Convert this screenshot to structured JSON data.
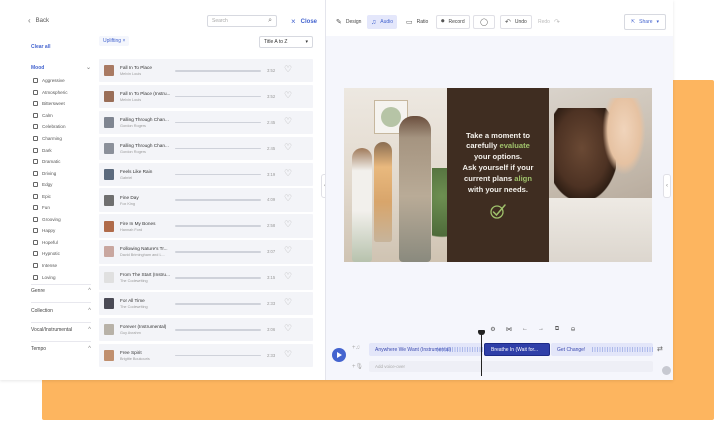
{
  "filter": {
    "back_label": "Back",
    "clear_all_label": "Clear all",
    "mood_title": "Mood",
    "moods": [
      "Aggressive",
      "Atmospheric",
      "Bittersweet",
      "Calm",
      "Celebration",
      "Charming",
      "Dark",
      "Dramatic",
      "Driving",
      "Edgy",
      "Epic",
      "Fun",
      "Grooving",
      "Happy",
      "Hopeful",
      "Hypnotic",
      "Intense",
      "Loving"
    ],
    "groups": [
      "Genre",
      "Collection",
      "Vocal/Instrumental",
      "Tempo"
    ]
  },
  "tracks_panel": {
    "search_placeholder": "Search",
    "close_label": "Close",
    "active_chip": "Uplifting",
    "sort_value": "Title A to Z",
    "tracks": [
      {
        "name": "Fall In To Place",
        "artist": "Melvin Louis",
        "duration": "3:52",
        "color": "#a97a63"
      },
      {
        "name": "Fall In To Place (Instru...",
        "artist": "Melvin Louis",
        "duration": "3:52",
        "color": "#9a6e58"
      },
      {
        "name": "Falling Through Chan...",
        "artist": "Gordon Rogers",
        "duration": "2:45",
        "color": "#7f8591"
      },
      {
        "name": "Falling Through Chan...",
        "artist": "Gordon Rogers",
        "duration": "2:45",
        "color": "#8b909a"
      },
      {
        "name": "Feels Like Rain",
        "artist": "Gabriel",
        "duration": "3:19",
        "color": "#5c6a7d"
      },
      {
        "name": "Fine Day",
        "artist": "Fox King",
        "duration": "4:09",
        "color": "#6f6f6f"
      },
      {
        "name": "Fire In My Bones",
        "artist": "Hannah Ford",
        "duration": "2:58",
        "color": "#b06b4a"
      },
      {
        "name": "Following Nature's Tr...",
        "artist": "David Brimingham and L...",
        "duration": "3:07",
        "color": "#c9a7a0"
      },
      {
        "name": "From The Start (Instru...",
        "artist": "The Codewriting",
        "duration": "3:15",
        "color": "#e0e0e0"
      },
      {
        "name": "For All Time",
        "artist": "The Codewriting",
        "duration": "2:33",
        "color": "#4a4a55"
      },
      {
        "name": "Forever (Instrumental)",
        "artist": "Guy Avrahm",
        "duration": "3:06",
        "color": "#b8b2a8"
      },
      {
        "name": "Free Spirit",
        "artist": "Brigitte Boukouris",
        "duration": "2:33",
        "color": "#c08f6e"
      }
    ]
  },
  "editor": {
    "tools": {
      "design": "Design",
      "audio": "Audio",
      "ratio": "Ratio",
      "record": "Record",
      "undo": "Undo",
      "redo": "Redo"
    },
    "share_label": "Share",
    "canvas": {
      "line1": "Take a moment to",
      "line2a": "carefully ",
      "line2b": "evaluate",
      "line3": "your options.",
      "line4": "Ask yourself if your",
      "line5a": "current plans ",
      "line5b": "align",
      "line6": "with your needs.",
      "accent": "#9fc16b",
      "panel_color": "#3f2d21"
    },
    "timeline": {
      "clips": [
        "Anywhere We Want (Instrumental)",
        "Breathe In (Wait for...",
        "Get Change!"
      ],
      "voiceover_placeholder": "Add voice-over"
    }
  },
  "colors": {
    "accent": "#4464cf",
    "page_bg": "#fdb55f"
  }
}
